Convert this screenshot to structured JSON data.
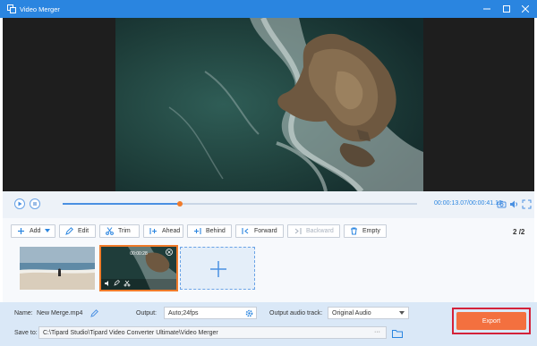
{
  "window": {
    "title": "Video Merger"
  },
  "playback": {
    "current_time": "00:00:13.07",
    "separator": "/",
    "total_time": "00:00:41.12",
    "progress": 0.33
  },
  "toolbar": {
    "add": "Add",
    "edit": "Edit",
    "trim": "Trim",
    "ahead": "Ahead",
    "behind": "Behind",
    "forward": "Forward",
    "backward": "Backward",
    "empty": "Empty"
  },
  "pager": {
    "current": "2",
    "total": "/2"
  },
  "clips": {
    "selected_duration": "00:00:28"
  },
  "output": {
    "name_label": "Name:",
    "name_value": "New Merge.mp4",
    "output_label": "Output:",
    "output_value": "Auto;24fps",
    "audio_label": "Output audio track:",
    "audio_value": "Original Audio",
    "save_label": "Save to:",
    "save_path": "C:\\Tipard Studio\\Tipard Video Converter Ultimate\\Video Merger",
    "more": "···"
  },
  "export_label": "Export",
  "colors": {
    "titlebar": "#2a85e0",
    "accent": "#4a90e2",
    "export": "#f3703f",
    "highlight": "#d4223a"
  },
  "icons": [
    "app-merge-icon",
    "minimize-icon",
    "maximize-icon",
    "close-icon",
    "play-icon",
    "stop-icon",
    "camera-icon",
    "volume-icon",
    "fullscreen-icon",
    "plus-icon",
    "chevron-down-icon",
    "edit-icon",
    "scissors-icon",
    "ahead-icon",
    "behind-icon",
    "forward-icon",
    "backward-icon",
    "trash-icon",
    "pencil-icon",
    "gear-icon",
    "folder-icon"
  ]
}
